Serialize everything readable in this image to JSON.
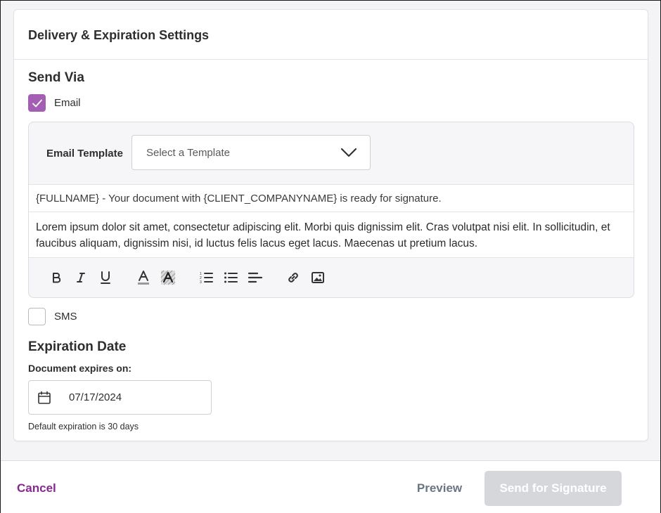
{
  "card": {
    "title": "Delivery & Expiration Settings"
  },
  "send_via": {
    "title": "Send Via",
    "email": {
      "label": "Email",
      "checked": true
    },
    "sms": {
      "label": "SMS",
      "checked": false
    }
  },
  "email_panel": {
    "template_label": "Email Template",
    "template_placeholder": "Select a Template",
    "subject": "{FULLNAME} - Your document with {CLIENT_COMPANYNAME} is ready for signature.",
    "body": "Lorem ipsum dolor sit amet, consectetur adipiscing elit. Morbi quis dignissim elit. Cras volutpat nisi elit. In sollicitudin, et faucibus aliquam, dignissim nisi, id luctus felis lacus eget lacus. Maecenas ut pretium lacus.",
    "toolbar": [
      "bold-icon",
      "italic-icon",
      "underline-icon",
      "text-color-icon",
      "highlight-icon",
      "ordered-list-icon",
      "bullet-list-icon",
      "align-icon",
      "link-icon",
      "image-icon"
    ]
  },
  "expiration": {
    "title": "Expiration Date",
    "label": "Document expires on:",
    "date": "07/17/2024",
    "hint": "Default expiration is 30 days"
  },
  "footer": {
    "cancel_label": "Cancel",
    "preview_label": "Preview",
    "send_label": "Send for Signature"
  },
  "colors": {
    "accent": "#a25fb3",
    "link": "#86288f",
    "disabled_button": "#d5d7db"
  }
}
